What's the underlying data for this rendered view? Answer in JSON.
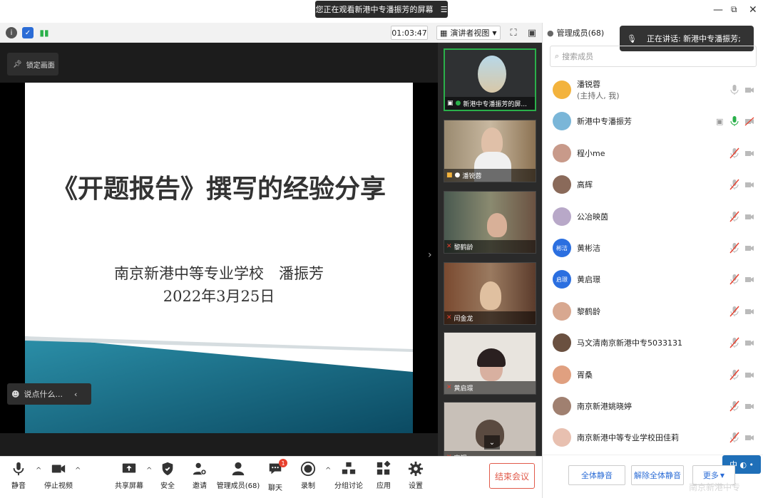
{
  "window": {
    "share_banner": "您正在观看新港中专潘振芳的屏幕",
    "menu_icon": "menu-icon",
    "controls": [
      "minimize-icon",
      "restore-icon",
      "close-icon"
    ]
  },
  "topstrip": {
    "timer": "01:03:47",
    "view_mode": "演讲者视图",
    "icons": [
      "info-icon",
      "shield-icon",
      "signal-icon",
      "fullscreen-icon",
      "sidebar-toggle-icon"
    ]
  },
  "stage": {
    "lock_label": "锁定画面",
    "slide_title": "《开题报告》撰写的经验分享",
    "slide_subtitle": "南京新港中等专业学校　潘振芳",
    "slide_date": "2022年3月25日",
    "chat_placeholder": "说点什么..."
  },
  "thumbnails": [
    {
      "label": "新港中专潘振芳的屏..."
    },
    {
      "label": "潘锐蓉"
    },
    {
      "label": "黎鹤龄"
    },
    {
      "label": "闫金龙"
    },
    {
      "label": "黄启璟"
    },
    {
      "label": "高辉"
    }
  ],
  "panel": {
    "title": "管理成员(68)",
    "speaking": "正在讲话: 新港中专潘振芳;",
    "search_placeholder": "搜索成员",
    "members": [
      {
        "name": "潘锐蓉",
        "sub": "(主持人, 我)",
        "avatar": "#f3b33d",
        "initials": ""
      },
      {
        "name": "新港中专潘振芳",
        "sub": "",
        "avatar": "#7ab6d8",
        "initials": ""
      },
      {
        "name": "程小me",
        "sub": "",
        "avatar": "#c89a8a",
        "initials": ""
      },
      {
        "name": "高辉",
        "sub": "",
        "avatar": "#8a6a5a",
        "initials": ""
      },
      {
        "name": "公冶映茵",
        "sub": "",
        "avatar": "#b8a8c8",
        "initials": ""
      },
      {
        "name": "黄彬洁",
        "sub": "",
        "avatar": "#2b6fe0",
        "initials": "彬洁"
      },
      {
        "name": "黄启璟",
        "sub": "",
        "avatar": "#2b6fe0",
        "initials": "启璟"
      },
      {
        "name": "黎鹤龄",
        "sub": "",
        "avatar": "#d8a890",
        "initials": ""
      },
      {
        "name": "马文清南京新港中专5033131",
        "sub": "",
        "avatar": "#6a5040",
        "initials": ""
      },
      {
        "name": "胥桑",
        "sub": "",
        "avatar": "#e0a080",
        "initials": ""
      },
      {
        "name": "南京新港姚晓婷",
        "sub": "",
        "avatar": "#a08070",
        "initials": ""
      },
      {
        "name": "南京新港中等专业学校田佳莉",
        "sub": "",
        "avatar": "#e8c0b0",
        "initials": ""
      }
    ],
    "mute_all": "全体静音",
    "unmute_all": "解除全体静音",
    "more": "更多",
    "ime": "中",
    "watermark": "南京新港中专"
  },
  "toolbar": {
    "mute": "静音",
    "stop_video": "停止视频",
    "share_screen": "共享屏幕",
    "security": "安全",
    "invite": "邀请",
    "manage_members": "管理成员(68)",
    "chat": "聊天",
    "chat_badge": "1",
    "record": "录制",
    "breakout": "分组讨论",
    "apps": "应用",
    "settings": "设置",
    "end_meeting": "结束会议"
  },
  "colors": {
    "accent_blue": "#2b6cd6",
    "end_red": "#e15a4a",
    "active_green": "#2ab04a"
  }
}
